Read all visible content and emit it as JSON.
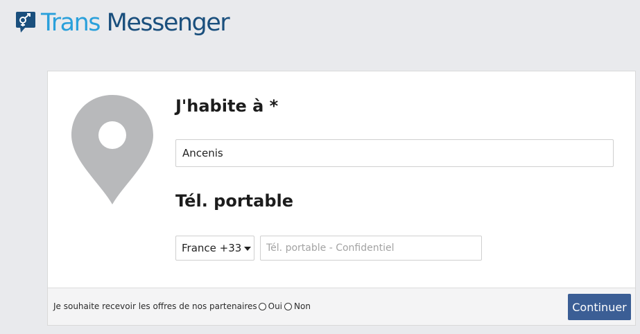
{
  "brand": {
    "name_part1": "Trans",
    "name_part2": "Messenger",
    "color_trans": "#2aa0db",
    "color_messenger": "#1a4f7d",
    "icon": "gender-symbol-chat-icon"
  },
  "form": {
    "city_label": "J'habite à *",
    "city_value": "Ancenis",
    "location_icon": "map-pin-icon",
    "phone_label": "Tél. portable",
    "country_selected": "France +33",
    "phone_placeholder": "Tél. portable - Confidentiel"
  },
  "footer": {
    "offers_text": "Je souhaite recevoir les offres de nos partenaires",
    "option_yes": "Oui",
    "option_no": "Non",
    "continue_label": "Continuer",
    "button_color": "#3b5e95"
  }
}
